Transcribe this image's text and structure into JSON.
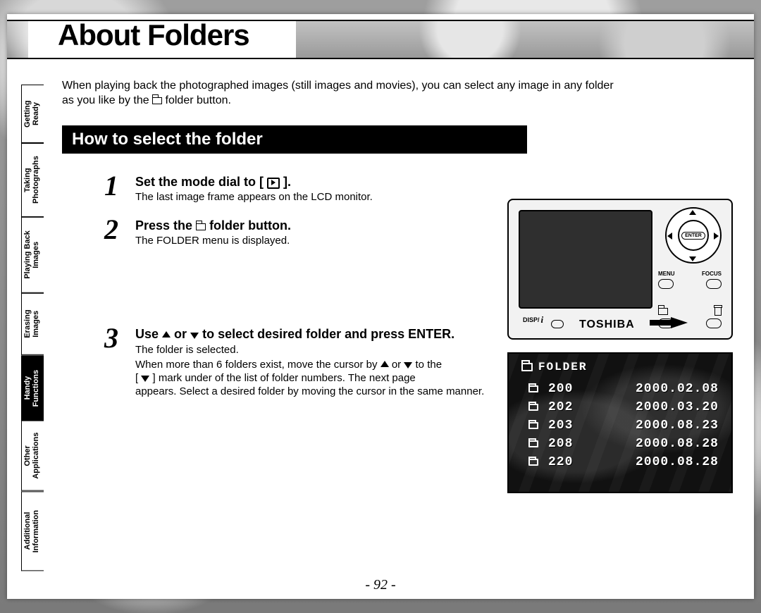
{
  "page": {
    "title": "About Folders",
    "number": "- 92 -"
  },
  "intro": {
    "line1": "When playing back the photographed images (still images and movies), you can select any image in any folder",
    "line2_pre": "as you like by the ",
    "line2_post": " folder button."
  },
  "section_bar": "How to select the folder",
  "steps": {
    "s1": {
      "num": "1",
      "head_pre": "Set the mode dial to [ ",
      "head_post": " ].",
      "sub": "The last image frame appears on the LCD monitor."
    },
    "s2": {
      "num": "2",
      "head_pre": "Press the ",
      "head_post": " folder button.",
      "sub": "The FOLDER menu is displayed."
    },
    "s3": {
      "num": "3",
      "head_pre": "Use ",
      "head_mid": " or ",
      "head_post": " to select desired folder and press ENTER.",
      "p1": "The folder is selected.",
      "p2_a": "When more than 6 folders exist, move the cursor by ",
      "p2_b": " or ",
      "p2_c": " to the",
      "p3_a": "[ ",
      "p3_b": " ] mark under of the list of folder numbers. The next page",
      "p4": "appears. Select a desired folder by moving the cursor in the same manner."
    }
  },
  "side_tabs": [
    {
      "label": "Getting Ready",
      "active": false
    },
    {
      "label": "Taking Photographs",
      "active": false
    },
    {
      "label": "Playing Back Images",
      "active": false
    },
    {
      "label": "Erasing Images",
      "active": false
    },
    {
      "label": "Handy Functions",
      "active": true
    },
    {
      "label": "Other Applications",
      "active": false
    },
    {
      "label": "Additional Information",
      "active": false
    }
  ],
  "camera": {
    "enter": "ENTER",
    "menu": "MENU",
    "focus": "FOCUS",
    "disp": "DISP/",
    "brand": "TOSHIBA"
  },
  "lcd": {
    "title": "FOLDER",
    "rows": [
      {
        "num": "200",
        "date": "2000.02.08"
      },
      {
        "num": "202",
        "date": "2000.03.20"
      },
      {
        "num": "203",
        "date": "2000.08.23"
      },
      {
        "num": "208",
        "date": "2000.08.28"
      },
      {
        "num": "220",
        "date": "2000.08.28"
      }
    ]
  }
}
